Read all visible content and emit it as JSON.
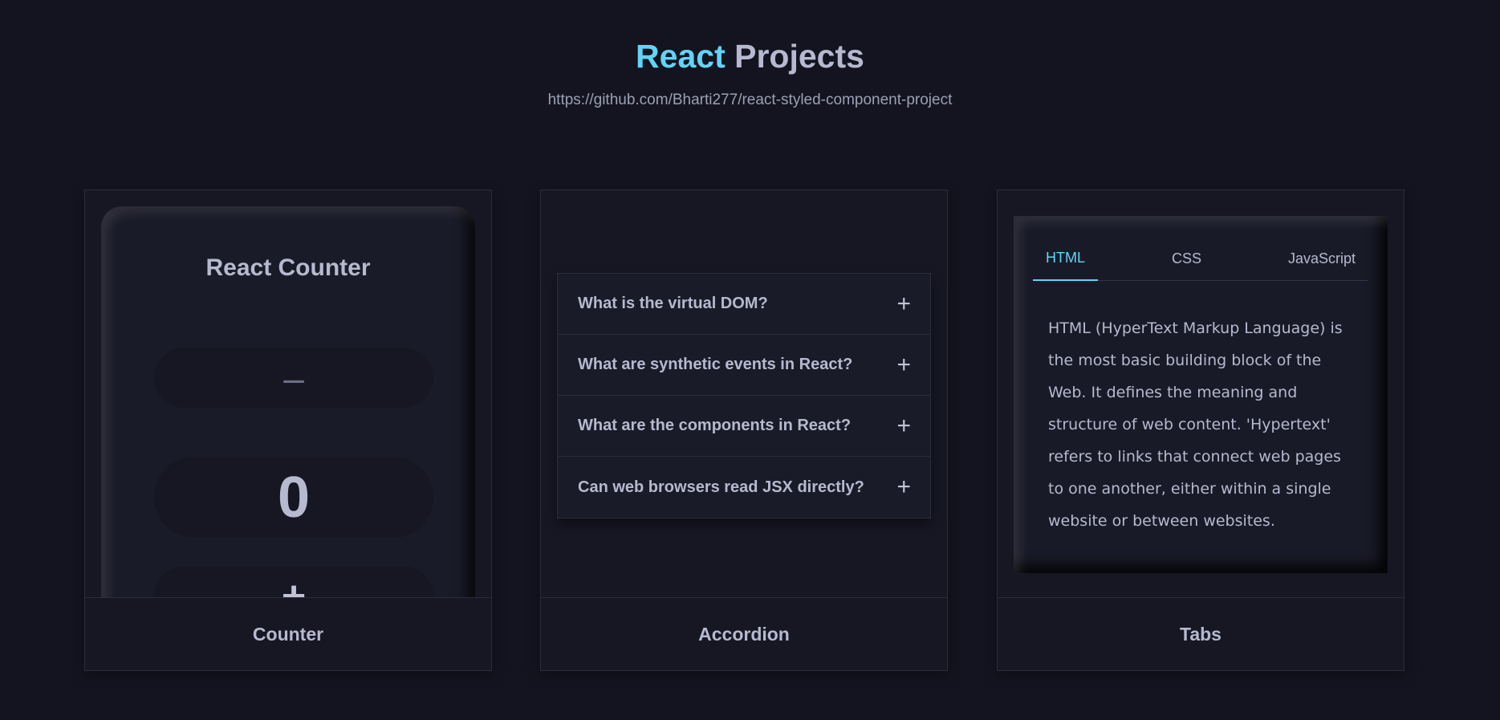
{
  "header": {
    "title_accent": "React",
    "title_rest": "Projects",
    "subtitle": "https://github.com/Bharti277/react-styled-component-project"
  },
  "colors": {
    "background": "#13141f",
    "accent": "#61d4f7",
    "text": "#b6b9cf"
  },
  "cards": {
    "counter": {
      "footer": "Counter",
      "title": "React Counter",
      "decrement_label": "–",
      "value": "0",
      "increment_label": "+"
    },
    "accordion": {
      "footer": "Accordion",
      "expand_icon": "plus-icon",
      "items": [
        {
          "question": "What is the virtual DOM?",
          "icon": "+"
        },
        {
          "question": "What are synthetic events in React?",
          "icon": "+"
        },
        {
          "question": "What are the components in React?",
          "icon": "+"
        },
        {
          "question": "Can web browsers read JSX directly?",
          "icon": "+"
        }
      ]
    },
    "tabs": {
      "footer": "Tabs",
      "active_tab": "HTML",
      "tab_labels": [
        "HTML",
        "CSS",
        "JavaScript"
      ],
      "content": "HTML (HyperText Markup Language) is the most basic building block of the Web. It defines the meaning and structure of web content. 'Hypertext' refers to links that connect web pages to one another, either within a single website or between websites."
    }
  }
}
